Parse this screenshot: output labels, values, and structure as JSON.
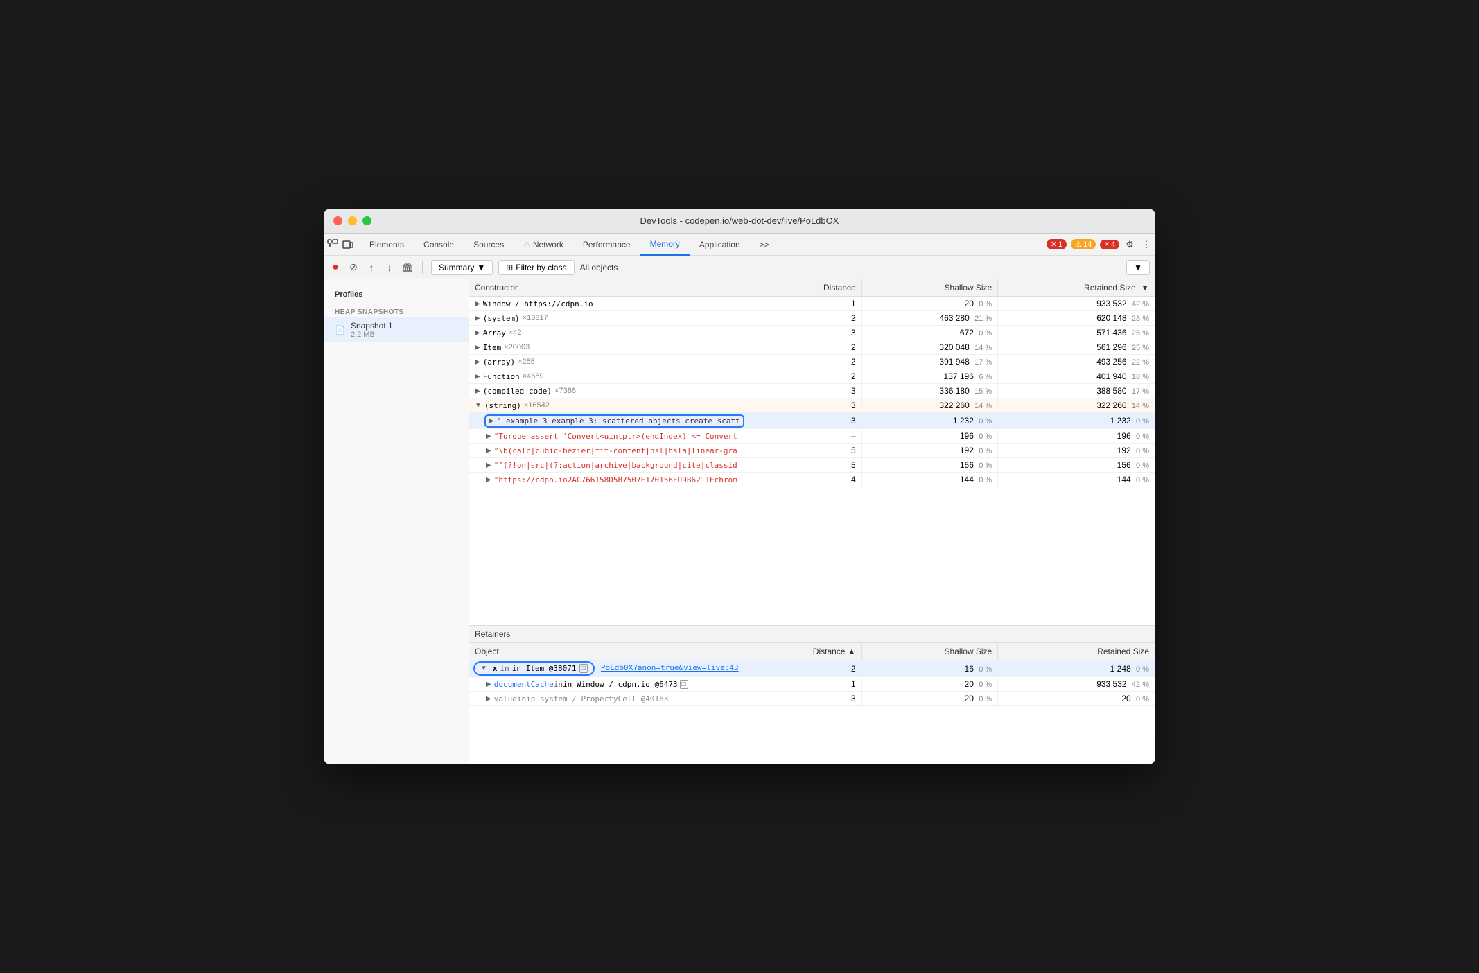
{
  "window": {
    "title": "DevTools - codepen.io/web-dot-dev/live/PoLdbOX"
  },
  "tabs": [
    {
      "label": "Elements",
      "active": false
    },
    {
      "label": "Console",
      "active": false
    },
    {
      "label": "Sources",
      "active": false
    },
    {
      "label": "Network",
      "active": false,
      "warning": "⚠"
    },
    {
      "label": "Performance",
      "active": false
    },
    {
      "label": "Memory",
      "active": true
    },
    {
      "label": "Application",
      "active": false
    },
    {
      "label": "More",
      "active": false
    }
  ],
  "status_badges": {
    "errors": {
      "icon": "✕",
      "count": "1"
    },
    "warnings": {
      "icon": "⚠",
      "count": "14"
    },
    "info": {
      "icon": "✕",
      "count": "4"
    }
  },
  "secondary_toolbar": {
    "record_label": "●",
    "stop_label": "⊘",
    "upload_label": "↑",
    "download_label": "↓",
    "clear_label": "🏛",
    "summary_label": "Summary",
    "filter_label": "Filter by class",
    "all_objects_label": "All objects"
  },
  "columns": {
    "constructor": "Constructor",
    "distance": "Distance",
    "shallow_size": "Shallow Size",
    "retained_size": "Retained Size"
  },
  "heap_rows": [
    {
      "indent": 0,
      "expanded": false,
      "constructor": "Window / https://cdpn.io",
      "type": "normal",
      "distance": "1",
      "shallow_num": "20",
      "shallow_pct": "0 %",
      "retained_num": "933 532",
      "retained_pct": "42 %"
    },
    {
      "indent": 0,
      "expanded": false,
      "constructor": "(system)",
      "count": "×13817",
      "type": "normal",
      "distance": "2",
      "shallow_num": "463 280",
      "shallow_pct": "21 %",
      "retained_num": "620 148",
      "retained_pct": "28 %"
    },
    {
      "indent": 0,
      "expanded": false,
      "constructor": "Array",
      "count": "×42",
      "type": "normal",
      "distance": "3",
      "shallow_num": "672",
      "shallow_pct": "0 %",
      "retained_num": "571 436",
      "retained_pct": "25 %"
    },
    {
      "indent": 0,
      "expanded": false,
      "constructor": "Item",
      "count": "×20003",
      "type": "normal",
      "distance": "2",
      "shallow_num": "320 048",
      "shallow_pct": "14 %",
      "retained_num": "561 296",
      "retained_pct": "25 %"
    },
    {
      "indent": 0,
      "expanded": false,
      "constructor": "(array)",
      "count": "×255",
      "type": "normal",
      "distance": "2",
      "shallow_num": "391 948",
      "shallow_pct": "17 %",
      "retained_num": "493 256",
      "retained_pct": "22 %"
    },
    {
      "indent": 0,
      "expanded": false,
      "constructor": "Function",
      "count": "×4689",
      "type": "normal",
      "distance": "2",
      "shallow_num": "137 196",
      "shallow_pct": "6 %",
      "retained_num": "401 940",
      "retained_pct": "18 %"
    },
    {
      "indent": 0,
      "expanded": false,
      "constructor": "(compiled code)",
      "count": "×7386",
      "type": "normal",
      "distance": "3",
      "shallow_num": "336 180",
      "shallow_pct": "15 %",
      "retained_num": "388 580",
      "retained_pct": "17 %"
    },
    {
      "indent": 0,
      "expanded": true,
      "constructor": "(string)",
      "count": "×16542",
      "type": "string",
      "distance": "3",
      "shallow_num": "322 260",
      "shallow_pct": "14 %",
      "retained_num": "322 260",
      "retained_pct": "14 %"
    },
    {
      "indent": 1,
      "expanded": false,
      "constructor": "\" example 3 example 3: scattered objects create scatt",
      "type": "selected-string",
      "distance": "3",
      "shallow_num": "1 232",
      "shallow_pct": "0 %",
      "retained_num": "1 232",
      "retained_pct": "0 %"
    },
    {
      "indent": 1,
      "expanded": false,
      "constructor": "\"Torque assert 'Convert<uintptr>(endIndex) <= Convert",
      "type": "red-string",
      "distance": "–",
      "shallow_num": "196",
      "shallow_pct": "0 %",
      "retained_num": "196",
      "retained_pct": "0 %"
    },
    {
      "indent": 1,
      "expanded": false,
      "constructor": "\"\\b(calc|cubic-bezier|fit-content|hsl|hsla|linear-gra",
      "type": "red-string",
      "distance": "5",
      "shallow_num": "192",
      "shallow_pct": "0 %",
      "retained_num": "192",
      "retained_pct": "0 %"
    },
    {
      "indent": 1,
      "expanded": false,
      "constructor": "\"^(?!on|src|(?:action|archive|background|cite|classid",
      "type": "red-string",
      "distance": "5",
      "shallow_num": "156",
      "shallow_pct": "0 %",
      "retained_num": "156",
      "retained_pct": "0 %"
    },
    {
      "indent": 1,
      "expanded": false,
      "constructor": "\"https://cdpn.io2AC766158D5B7507E170156ED9B6211Echrom",
      "type": "red-string",
      "distance": "4",
      "shallow_num": "144",
      "shallow_pct": "0 %",
      "retained_num": "144",
      "retained_pct": "0 %"
    }
  ],
  "retainers": {
    "header": "Retainers",
    "columns": {
      "object": "Object",
      "distance": "Distance",
      "shallow_size": "Shallow Size",
      "retained_size": "Retained Size"
    },
    "rows": [
      {
        "indent": 0,
        "expanded": true,
        "selected": true,
        "object_pre": "x",
        "object_in": "in Item @38071",
        "object_window_icon": true,
        "link": "PoLdb0X?anon=true&view=live:43",
        "distance": "2",
        "shallow_num": "16",
        "shallow_pct": "0 %",
        "retained_num": "1 248",
        "retained_pct": "0 %"
      },
      {
        "indent": 1,
        "expanded": false,
        "selected": false,
        "object_pre": "documentCache",
        "object_in": "in Window / cdpn.io @6473",
        "object_window_icon": true,
        "link": null,
        "distance": "1",
        "shallow_num": "20",
        "shallow_pct": "0 %",
        "retained_num": "933 532",
        "retained_pct": "42 %"
      },
      {
        "indent": 1,
        "expanded": false,
        "selected": false,
        "object_pre": "value",
        "object_in": "in system / PropertyCell @40163",
        "object_window_icon": false,
        "link": null,
        "distance": "3",
        "shallow_num": "20",
        "shallow_pct": "0 %",
        "retained_num": "20",
        "retained_pct": "0 %"
      }
    ]
  },
  "sidebar": {
    "title": "Profiles",
    "section_title": "HEAP SNAPSHOTS",
    "snapshot_name": "Snapshot 1",
    "snapshot_size": "2.2 MB"
  }
}
